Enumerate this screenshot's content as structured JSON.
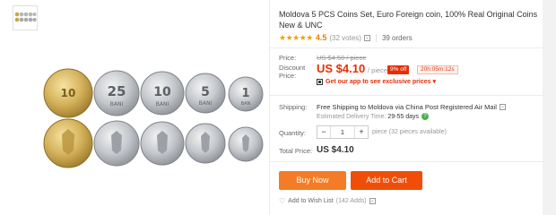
{
  "product": {
    "title": "Moldova 5 PCS Coins Set, Euro Foreign coin, 100% Real Original Coins New & UNC",
    "rating_stars": "★★★★★",
    "rating": "4.5",
    "votes": "(32 votes)",
    "votes_chevron": "⌄",
    "orders": "39 orders"
  },
  "price": {
    "price_label": "Price:",
    "old_price": "US $4.50 / piece",
    "discount_label": "Discount Price:",
    "discount_price": "US $4.10",
    "per_piece": "/ piece",
    "off_badge": "9% off",
    "timer": "20h:05m:12s",
    "app_promo": "Get our app to see exclusive prices ▾"
  },
  "shipping": {
    "label": "Shipping:",
    "text": "Free Shipping to Moldova via China Post Registered Air Mail",
    "chevron": "⌄",
    "estimated_label": "Estimated Delivery Time:",
    "estimated_value": "29-55 days",
    "help_icon": "?"
  },
  "quantity": {
    "label": "Quantity:",
    "minus": "−",
    "value": "1",
    "plus": "+",
    "available": "piece (32 pieces available)"
  },
  "total": {
    "label": "Total Price:",
    "value": "US $4.10"
  },
  "actions": {
    "buy_now": "Buy Now",
    "add_to_cart": "Add to Cart"
  },
  "wishlist": {
    "heart_icon": "♡",
    "label": "Add to Wish List",
    "count": "(142 Adds)",
    "chevron": "⌄"
  },
  "coins_top": [
    "10",
    "25",
    "10",
    "5",
    "1"
  ],
  "coins_bottom_word": "BANI",
  "colors": {
    "accent": "#e62e04",
    "buy_now": "#f57c26",
    "add_to_cart": "#f04e08",
    "star": "#f0a30a"
  }
}
